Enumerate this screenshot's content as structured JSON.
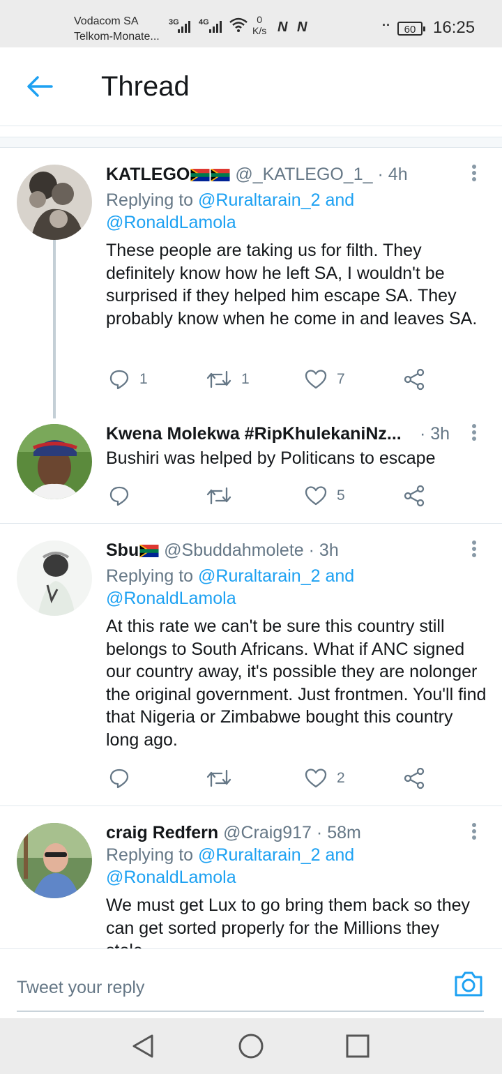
{
  "status_bar": {
    "carrier_1": "Vodacom SA",
    "carrier_2": "Telkom-Monate...",
    "network_1": "3G",
    "network_2": "4G",
    "speed_value": "0",
    "speed_unit": "K/s",
    "notifications": "N N",
    "ellipsis": "··",
    "battery": "60",
    "time": "16:25"
  },
  "header": {
    "title": "Thread"
  },
  "tweets": [
    {
      "name": "KATLEGO",
      "handle": "@_KATLEGO_1_",
      "time": "· 4h",
      "replying_prefix": "Replying to",
      "mention_1": "@Ruraltarain_2",
      "and": "and",
      "mention_2": "@RonaldLamola",
      "text": "These people are taking us for filth. They definitely know how he left SA, I wouldn't be surprised if they helped him escape SA. They probably know when he come in and leaves SA.",
      "replies": "1",
      "retweets": "1",
      "likes": "7"
    },
    {
      "name": "Kwena Molekwa #RipKhulekaniNz...",
      "time": "· 3h",
      "text": "Bushiri was helped by Politicans to escape",
      "replies": "",
      "retweets": "",
      "likes": "5"
    },
    {
      "name": "Sbu",
      "handle": "@Sbuddahmolete",
      "time": "· 3h",
      "replying_prefix": "Replying to",
      "mention_1": "@Ruraltarain_2",
      "and": "and",
      "mention_2": "@RonaldLamola",
      "text": "At this rate  we can't be sure this country still belongs to South Africans. What if ANC signed our country away, it's possible they are nolonger the original government. Just frontmen. You'll find that Nigeria or Zimbabwe bought this country long ago.",
      "replies": "",
      "retweets": "",
      "likes": "2"
    },
    {
      "name": "craig Redfern",
      "handle": "@Craig917",
      "time": "· 58m",
      "replying_prefix": "Replying to",
      "mention_1": "@Ruraltarain_2",
      "and": "and",
      "mention_2": "@RonaldLamola",
      "text": "We must get Lux to go bring them back so they can get sorted properly for the Millions they stole"
    }
  ],
  "reply_bar": {
    "placeholder": "Tweet your reply"
  },
  "colors": {
    "accent": "#1da1f2",
    "secondary_text": "#657786",
    "primary_text": "#14171a"
  },
  "icons": {
    "back": "arrow-left-icon",
    "more": "more-vertical-icon",
    "reply": "reply-bubble-icon",
    "retweet": "retweet-icon",
    "like": "heart-icon",
    "share": "share-icon",
    "camera": "camera-icon"
  }
}
